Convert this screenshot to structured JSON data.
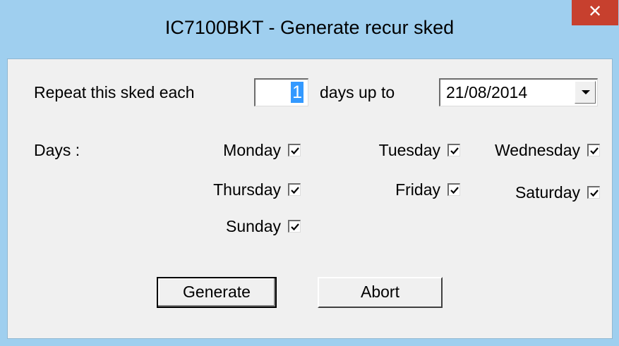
{
  "window": {
    "title": "IC7100BKT - Generate recur sked",
    "close_label": "✕"
  },
  "repeat": {
    "prefix_label": "Repeat this sked each",
    "interval_value": "1",
    "suffix_label": "days up to",
    "end_date": "21/08/2014"
  },
  "days": {
    "label": "Days :",
    "items": [
      {
        "name": "Monday",
        "checked": true
      },
      {
        "name": "Tuesday",
        "checked": true
      },
      {
        "name": "Wednesday",
        "checked": true
      },
      {
        "name": "Thursday",
        "checked": true
      },
      {
        "name": "Friday",
        "checked": true
      },
      {
        "name": "Saturday",
        "checked": true
      },
      {
        "name": "Sunday",
        "checked": true
      }
    ]
  },
  "buttons": {
    "generate_label": "Generate",
    "abort_label": "Abort"
  }
}
